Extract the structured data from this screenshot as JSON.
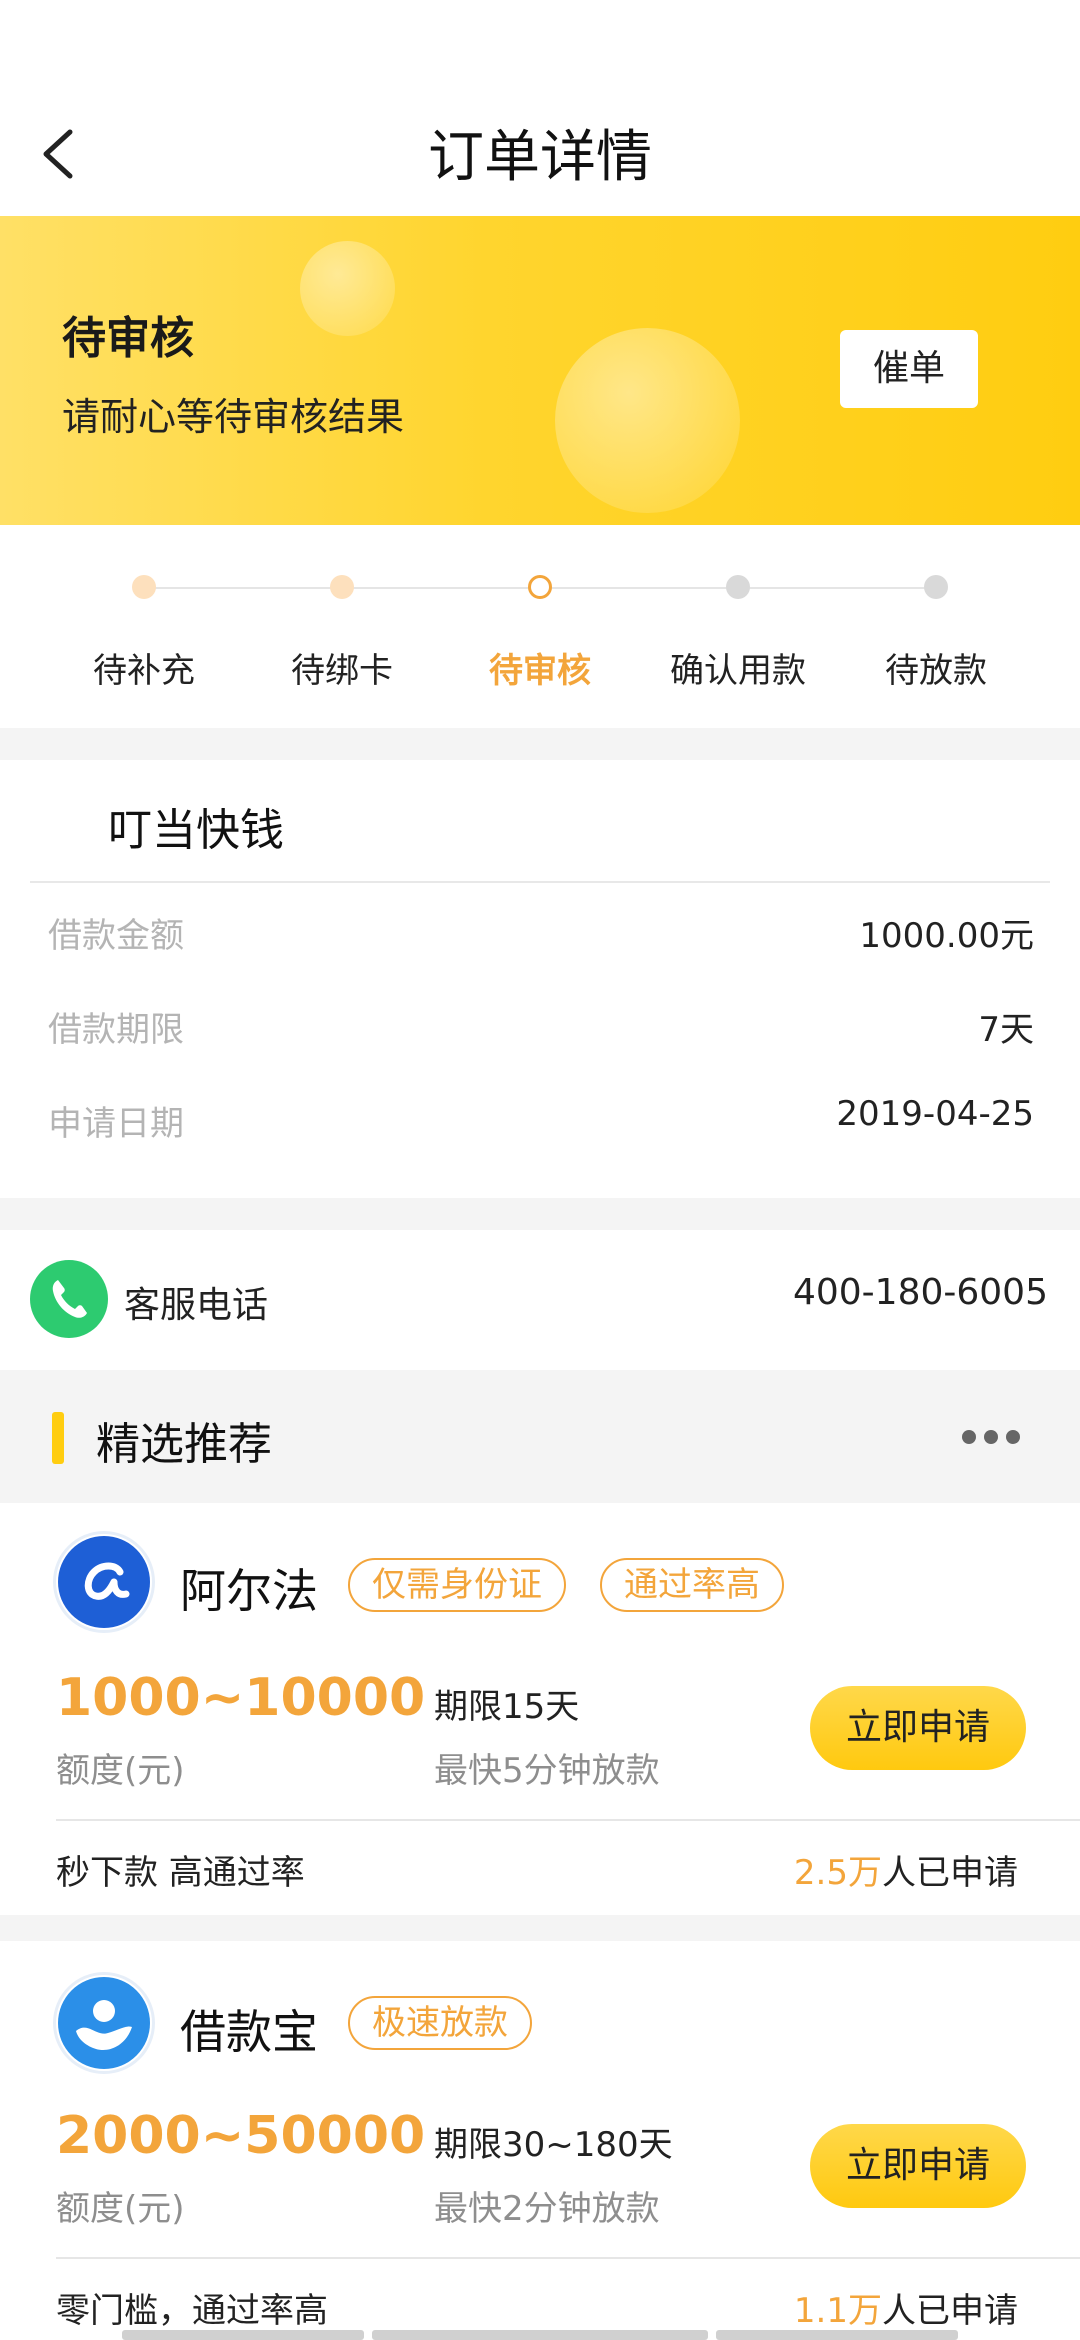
{
  "header": {
    "title": "订单详情"
  },
  "banner": {
    "status_title": "待审核",
    "status_desc": "请耐心等待审核结果",
    "urge_label": "催单"
  },
  "steps": [
    {
      "label": "待补充",
      "state": "done"
    },
    {
      "label": "待绑卡",
      "state": "done"
    },
    {
      "label": "待审核",
      "state": "active"
    },
    {
      "label": "确认用款",
      "state": "todo"
    },
    {
      "label": "待放款",
      "state": "todo"
    }
  ],
  "loan": {
    "title": "叮当快钱",
    "rows": [
      {
        "label": "借款金额",
        "value": "1000.00元"
      },
      {
        "label": "借款期限",
        "value": "7天"
      },
      {
        "label": "申请日期",
        "value": "2019-04-25"
      }
    ]
  },
  "service": {
    "label": "客服电话",
    "number": "400-180-6005"
  },
  "recommend": {
    "title": "精选推荐"
  },
  "products": [
    {
      "name": "阿尔法",
      "tags": [
        "仅需身份证",
        "通过率高"
      ],
      "amount": "1000~10000",
      "amount_label": "额度(元)",
      "term": "期限15天",
      "speed": "最快5分钟放款",
      "apply_label": "立即申请",
      "feature": "秒下款 高通过率",
      "applied_num": "2.5万",
      "applied_suffix": "人已申请"
    },
    {
      "name": "借款宝",
      "tags": [
        "极速放款"
      ],
      "amount": "2000~50000",
      "amount_label": "额度(元)",
      "term": "期限30~180天",
      "speed": "最快2分钟放款",
      "apply_label": "立即申请",
      "feature": "零门槛，通过率高",
      "applied_num": "1.1万",
      "applied_suffix": "人已申请"
    }
  ],
  "colors": {
    "accent": "#f3a53b",
    "banner": "#ffd52e",
    "button": "#ffc90f",
    "phone": "#2dcb70"
  }
}
